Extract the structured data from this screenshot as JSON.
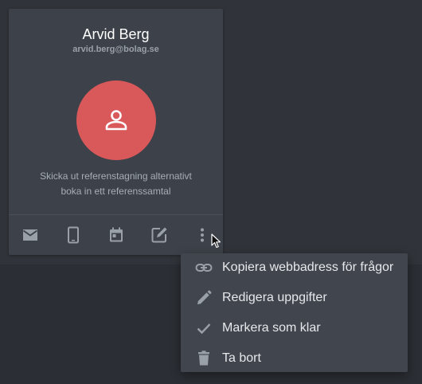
{
  "contact": {
    "name": "Arvid Berg",
    "email": "arvid.berg@bolag.se",
    "description_line1": "Skicka ut referenstagning alternativt",
    "description_line2": "boka in ett referenssamtal",
    "avatar_icon": "person-icon",
    "avatar_color": "#d9585a"
  },
  "actions": [
    {
      "icon": "mail-icon"
    },
    {
      "icon": "phone-icon"
    },
    {
      "icon": "calendar-icon"
    },
    {
      "icon": "edit-note-icon"
    },
    {
      "icon": "more-vert-icon"
    }
  ],
  "menu": {
    "items": [
      {
        "icon": "link-icon",
        "label": "Kopiera webbadress för frågor"
      },
      {
        "icon": "pencil-icon",
        "label": "Redigera uppgifter"
      },
      {
        "icon": "check-icon",
        "label": "Markera som klar"
      },
      {
        "icon": "trash-icon",
        "label": "Ta bort"
      }
    ]
  },
  "colors": {
    "background": "#303339",
    "card": "#3d424a",
    "menu": "#41464e",
    "icon": "#9aa0a8"
  }
}
